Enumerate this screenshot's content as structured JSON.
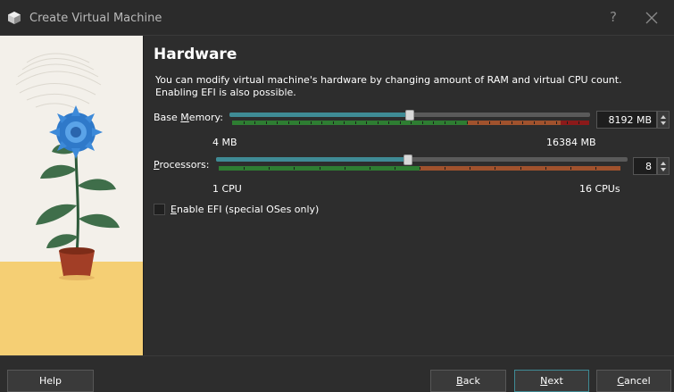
{
  "window": {
    "title": "Create Virtual Machine",
    "help_glyph": "?",
    "close_glyph": "✕"
  },
  "page": {
    "heading": "Hardware",
    "description_line1": "You can modify virtual machine's hardware by changing amount of RAM and virtual CPU count.",
    "description_line2": "Enabling EFI is also possible."
  },
  "memory": {
    "label_pre": "Base ",
    "label_mnemonic": "M",
    "label_post": "emory:",
    "value": 8192,
    "min": 4,
    "max": 16384,
    "min_label": "4 MB",
    "max_label": "16384 MB",
    "spin_text": "8192 MB",
    "recommended_fraction": 0.66,
    "warning_fraction": 0.92
  },
  "processors": {
    "label_mnemonic": "P",
    "label_post": "rocessors:",
    "value": 8,
    "min": 1,
    "max": 16,
    "min_label": "1 CPU",
    "max_label": "16 CPUs",
    "spin_text": "8",
    "recommended_fraction": 0.5
  },
  "efi": {
    "label_mnemonic": "E",
    "label_post": "nable EFI (special OSes only)",
    "checked": false
  },
  "buttons": {
    "help": "Help",
    "back_mnemonic": "B",
    "back_post": "ack",
    "next_mnemonic": "N",
    "next_post": "ext",
    "cancel_mnemonic": "C",
    "cancel_post": "ancel"
  },
  "colors": {
    "slider_green": "#2e7d32",
    "slider_orange": "#a0522d",
    "slider_red": "#8b1a1a",
    "accent_teal": "#3f8b95"
  }
}
